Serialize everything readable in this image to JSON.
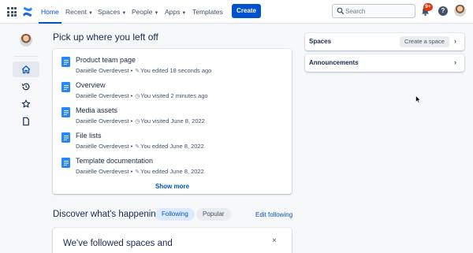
{
  "topbar": {
    "nav": [
      {
        "label": "Home",
        "active": true,
        "dropdown": false
      },
      {
        "label": "Recent",
        "active": false,
        "dropdown": true
      },
      {
        "label": "Spaces",
        "active": false,
        "dropdown": true
      },
      {
        "label": "People",
        "active": false,
        "dropdown": true
      },
      {
        "label": "Apps",
        "active": false,
        "dropdown": true
      },
      {
        "label": "Templates",
        "active": false,
        "dropdown": false
      }
    ],
    "create_label": "Create",
    "search_placeholder": "Search",
    "notification_badge": "9+",
    "help_symbol": "?",
    "icons": [
      "app-switcher-icon",
      "confluence-logo-icon",
      "search-icon",
      "bell-icon",
      "help-icon"
    ],
    "accent_color": "#0052cc"
  },
  "main": {
    "heading": "Pick up where you left off",
    "recent_items": [
      {
        "title": "Product team page",
        "author": "Daniëlle Overdevest",
        "action_icon": "edit-icon",
        "activity": "You edited 18 seconds ago"
      },
      {
        "title": "Overview",
        "author": "Daniëlle Overdevest",
        "action_icon": "clock-icon",
        "activity": "You visited 2 minutes ago"
      },
      {
        "title": "Media assets",
        "author": "Daniëlle Overdevest",
        "action_icon": "clock-icon",
        "activity": "You visited June 8, 2022"
      },
      {
        "title": "File lists",
        "author": "Daniëlle Overdevest",
        "action_icon": "edit-icon",
        "activity": "You edited June 8, 2022"
      },
      {
        "title": "Template documentation",
        "author": "Daniëlle Overdevest",
        "action_icon": "edit-icon",
        "activity": "You edited June 8, 2022"
      }
    ],
    "show_more_label": "Show more",
    "discover": {
      "heading": "Discover what's happening",
      "tabs": [
        "Following",
        "Popular"
      ],
      "active_tab": "Following",
      "edit_label": "Edit following"
    },
    "followed_card_text": "We've followed spaces and",
    "close_symbol": "×"
  },
  "sidebar": {
    "items": [
      {
        "icon": "home-icon",
        "active": true
      },
      {
        "icon": "history-icon",
        "active": false
      },
      {
        "icon": "star-icon",
        "active": false
      },
      {
        "icon": "page-icon",
        "active": false
      }
    ]
  },
  "right": {
    "spaces_label": "Spaces",
    "create_space_label": "Create a space",
    "announcements_label": "Announcements"
  }
}
